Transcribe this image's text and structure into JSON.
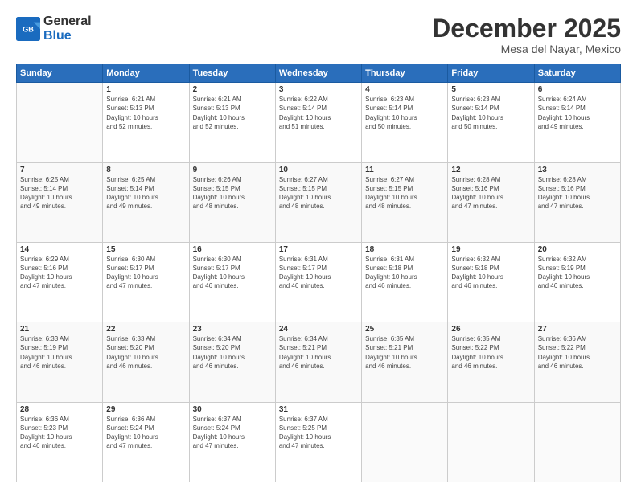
{
  "logo": {
    "line1": "General",
    "line2": "Blue"
  },
  "header": {
    "month": "December 2025",
    "location": "Mesa del Nayar, Mexico"
  },
  "weekdays": [
    "Sunday",
    "Monday",
    "Tuesday",
    "Wednesday",
    "Thursday",
    "Friday",
    "Saturday"
  ],
  "weeks": [
    [
      {
        "day": "",
        "info": ""
      },
      {
        "day": "1",
        "info": "Sunrise: 6:21 AM\nSunset: 5:13 PM\nDaylight: 10 hours\nand 52 minutes."
      },
      {
        "day": "2",
        "info": "Sunrise: 6:21 AM\nSunset: 5:13 PM\nDaylight: 10 hours\nand 52 minutes."
      },
      {
        "day": "3",
        "info": "Sunrise: 6:22 AM\nSunset: 5:14 PM\nDaylight: 10 hours\nand 51 minutes."
      },
      {
        "day": "4",
        "info": "Sunrise: 6:23 AM\nSunset: 5:14 PM\nDaylight: 10 hours\nand 50 minutes."
      },
      {
        "day": "5",
        "info": "Sunrise: 6:23 AM\nSunset: 5:14 PM\nDaylight: 10 hours\nand 50 minutes."
      },
      {
        "day": "6",
        "info": "Sunrise: 6:24 AM\nSunset: 5:14 PM\nDaylight: 10 hours\nand 49 minutes."
      }
    ],
    [
      {
        "day": "7",
        "info": "Sunrise: 6:25 AM\nSunset: 5:14 PM\nDaylight: 10 hours\nand 49 minutes."
      },
      {
        "day": "8",
        "info": "Sunrise: 6:25 AM\nSunset: 5:14 PM\nDaylight: 10 hours\nand 49 minutes."
      },
      {
        "day": "9",
        "info": "Sunrise: 6:26 AM\nSunset: 5:15 PM\nDaylight: 10 hours\nand 48 minutes."
      },
      {
        "day": "10",
        "info": "Sunrise: 6:27 AM\nSunset: 5:15 PM\nDaylight: 10 hours\nand 48 minutes."
      },
      {
        "day": "11",
        "info": "Sunrise: 6:27 AM\nSunset: 5:15 PM\nDaylight: 10 hours\nand 48 minutes."
      },
      {
        "day": "12",
        "info": "Sunrise: 6:28 AM\nSunset: 5:16 PM\nDaylight: 10 hours\nand 47 minutes."
      },
      {
        "day": "13",
        "info": "Sunrise: 6:28 AM\nSunset: 5:16 PM\nDaylight: 10 hours\nand 47 minutes."
      }
    ],
    [
      {
        "day": "14",
        "info": "Sunrise: 6:29 AM\nSunset: 5:16 PM\nDaylight: 10 hours\nand 47 minutes."
      },
      {
        "day": "15",
        "info": "Sunrise: 6:30 AM\nSunset: 5:17 PM\nDaylight: 10 hours\nand 47 minutes."
      },
      {
        "day": "16",
        "info": "Sunrise: 6:30 AM\nSunset: 5:17 PM\nDaylight: 10 hours\nand 46 minutes."
      },
      {
        "day": "17",
        "info": "Sunrise: 6:31 AM\nSunset: 5:17 PM\nDaylight: 10 hours\nand 46 minutes."
      },
      {
        "day": "18",
        "info": "Sunrise: 6:31 AM\nSunset: 5:18 PM\nDaylight: 10 hours\nand 46 minutes."
      },
      {
        "day": "19",
        "info": "Sunrise: 6:32 AM\nSunset: 5:18 PM\nDaylight: 10 hours\nand 46 minutes."
      },
      {
        "day": "20",
        "info": "Sunrise: 6:32 AM\nSunset: 5:19 PM\nDaylight: 10 hours\nand 46 minutes."
      }
    ],
    [
      {
        "day": "21",
        "info": "Sunrise: 6:33 AM\nSunset: 5:19 PM\nDaylight: 10 hours\nand 46 minutes."
      },
      {
        "day": "22",
        "info": "Sunrise: 6:33 AM\nSunset: 5:20 PM\nDaylight: 10 hours\nand 46 minutes."
      },
      {
        "day": "23",
        "info": "Sunrise: 6:34 AM\nSunset: 5:20 PM\nDaylight: 10 hours\nand 46 minutes."
      },
      {
        "day": "24",
        "info": "Sunrise: 6:34 AM\nSunset: 5:21 PM\nDaylight: 10 hours\nand 46 minutes."
      },
      {
        "day": "25",
        "info": "Sunrise: 6:35 AM\nSunset: 5:21 PM\nDaylight: 10 hours\nand 46 minutes."
      },
      {
        "day": "26",
        "info": "Sunrise: 6:35 AM\nSunset: 5:22 PM\nDaylight: 10 hours\nand 46 minutes."
      },
      {
        "day": "27",
        "info": "Sunrise: 6:36 AM\nSunset: 5:22 PM\nDaylight: 10 hours\nand 46 minutes."
      }
    ],
    [
      {
        "day": "28",
        "info": "Sunrise: 6:36 AM\nSunset: 5:23 PM\nDaylight: 10 hours\nand 46 minutes."
      },
      {
        "day": "29",
        "info": "Sunrise: 6:36 AM\nSunset: 5:24 PM\nDaylight: 10 hours\nand 47 minutes."
      },
      {
        "day": "30",
        "info": "Sunrise: 6:37 AM\nSunset: 5:24 PM\nDaylight: 10 hours\nand 47 minutes."
      },
      {
        "day": "31",
        "info": "Sunrise: 6:37 AM\nSunset: 5:25 PM\nDaylight: 10 hours\nand 47 minutes."
      },
      {
        "day": "",
        "info": ""
      },
      {
        "day": "",
        "info": ""
      },
      {
        "day": "",
        "info": ""
      }
    ]
  ]
}
